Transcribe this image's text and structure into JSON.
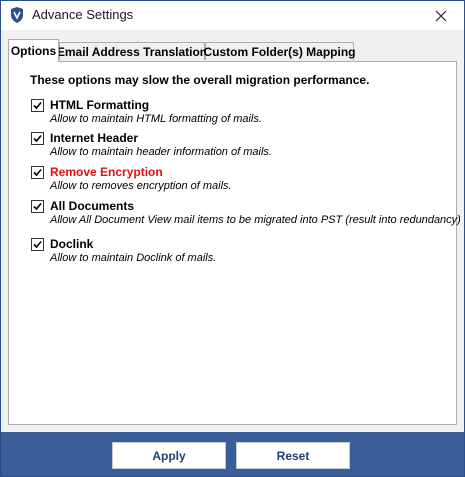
{
  "window": {
    "title": "Advance Settings"
  },
  "tabs": [
    {
      "label": "Options",
      "active": true
    },
    {
      "label": "Email Address Translation",
      "active": false
    },
    {
      "label": "Custom Folder(s) Mapping",
      "active": false
    }
  ],
  "notice": "These options may slow the overall migration performance.",
  "options": [
    {
      "label": "HTML Formatting",
      "description": "Allow to maintain HTML formatting of mails.",
      "checked": true
    },
    {
      "label": "Internet Header",
      "description": "Allow to maintain header information of mails.",
      "checked": true
    },
    {
      "label": "Remove Encryption",
      "description": "Allow to removes encryption of mails.",
      "checked": true,
      "color": "#e01010"
    },
    {
      "label": "All Documents",
      "description": "Allow All Document View mail items to be migrated into PST (result into redundancy)",
      "checked": true
    },
    {
      "label": "Doclink",
      "description": "Allow to maintain Doclink of mails.",
      "checked": true
    }
  ],
  "buttons": {
    "apply": "Apply",
    "reset": "Reset"
  },
  "colors": {
    "footer": "#3a5e97",
    "highlight_label": "#e01010",
    "button_text": "#1f3f7a"
  },
  "icons": {
    "app": "shield-v-icon",
    "close": "close-icon",
    "check": "check-icon"
  }
}
